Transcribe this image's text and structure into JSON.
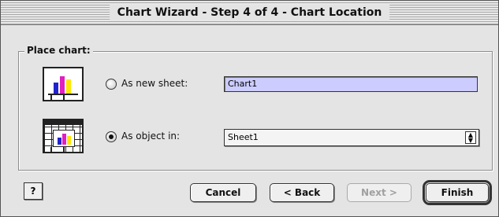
{
  "window": {
    "title": "Chart Wizard - Step 4 of 4 - Chart Location"
  },
  "place_chart": {
    "group_label": "Place chart:",
    "option_new_sheet": {
      "label": "As new sheet:",
      "selected": false,
      "value": "Chart1"
    },
    "option_object_in": {
      "label": "As object in:",
      "selected": true,
      "value": "Sheet1"
    }
  },
  "buttons": {
    "help": "?",
    "cancel": "Cancel",
    "back": "< Back",
    "next": "Next >",
    "finish": "Finish"
  },
  "icons": [
    "new-chart-sheet-icon",
    "embedded-chart-icon",
    "radio-icon",
    "popup-arrows-icon"
  ],
  "colors": {
    "bar_blue": "#2222cc",
    "bar_magenta": "#e020c0",
    "bar_yellow": "#ffe600",
    "field_highlight": "#ccccff"
  }
}
